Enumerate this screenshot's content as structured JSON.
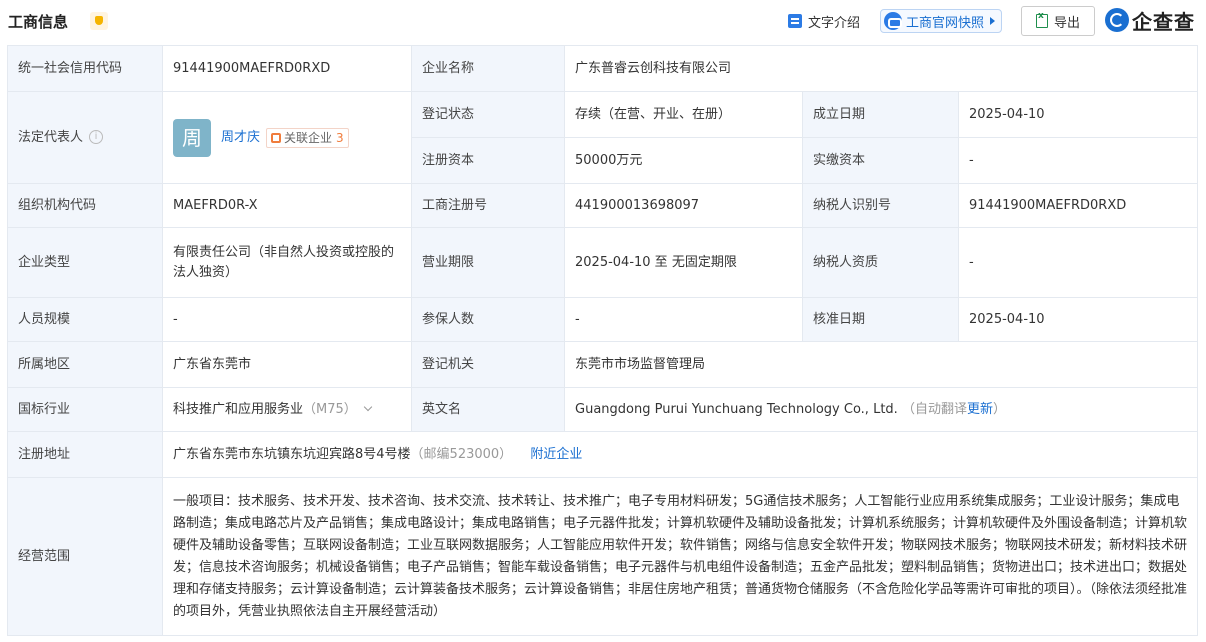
{
  "header": {
    "title": "工商信息",
    "intro_label": "文字介绍",
    "snapshot_label": "工商官网快照",
    "export_label": "导出",
    "logo_text": "企查查"
  },
  "rows": {
    "credit_code_label": "统一社会信用代码",
    "credit_code": "91441900MAEFRD0RXD",
    "company_name_label": "企业名称",
    "company_name": "广东普睿云创科技有限公司",
    "legal_rep_label": "法定代表人",
    "legal_rep_avatar": "周",
    "legal_rep_name": "周才庆",
    "related_label": "关联企业",
    "related_count": "3",
    "reg_status_label": "登记状态",
    "reg_status": "存续（在营、开业、在册）",
    "found_date_label": "成立日期",
    "found_date": "2025-04-10",
    "reg_capital_label": "注册资本",
    "reg_capital": "50000万元",
    "paid_capital_label": "实缴资本",
    "paid_capital": "-",
    "org_code_label": "组织机构代码",
    "org_code": "MAEFRD0R-X",
    "biz_reg_no_label": "工商注册号",
    "biz_reg_no": "441900013698097",
    "taxpayer_id_label": "纳税人识别号",
    "taxpayer_id": "91441900MAEFRD0RXD",
    "company_type_label": "企业类型",
    "company_type": "有限责任公司（非自然人投资或控股的法人独资）",
    "biz_term_label": "营业期限",
    "biz_term": "2025-04-10 至 无固定期限",
    "taxpayer_qual_label": "纳税人资质",
    "taxpayer_qual": "-",
    "staff_size_label": "人员规模",
    "staff_size": "-",
    "insured_label": "参保人数",
    "insured": "-",
    "approval_date_label": "核准日期",
    "approval_date": "2025-04-10",
    "region_label": "所属地区",
    "region": "广东省东莞市",
    "reg_authority_label": "登记机关",
    "reg_authority": "东莞市市场监督管理局",
    "industry_label": "国标行业",
    "industry": "科技推广和应用服务业",
    "industry_code": "（M75）",
    "english_name_label": "英文名",
    "english_name": "Guangdong Purui Yunchuang Technology Co., Ltd.",
    "auto_translate": "（自动翻译",
    "update_link": "更新",
    "auto_translate_end": "）",
    "address_label": "注册地址",
    "address": "广东省东莞市东坑镇东坑迎宾路8号4号楼",
    "postcode": "（邮编523000）",
    "nearby_link": "附近企业",
    "scope_label": "经营范围",
    "scope": "一般项目：技术服务、技术开发、技术咨询、技术交流、技术转让、技术推广；电子专用材料研发；5G通信技术服务；人工智能行业应用系统集成服务；工业设计服务；集成电路制造；集成电路芯片及产品销售；集成电路设计；集成电路销售；电子元器件批发；计算机软硬件及辅助设备批发；计算机系统服务；计算机软硬件及外围设备制造；计算机软硬件及辅助设备零售；互联网设备制造；工业互联网数据服务；人工智能应用软件开发；软件销售；网络与信息安全软件开发；物联网技术服务；物联网技术研发；新材料技术研发；信息技术咨询服务；机械设备销售；电子产品销售；智能车载设备销售；电子元器件与机电组件设备制造；五金产品批发；塑料制品销售；货物进出口；技术进出口；数据处理和存储支持服务；云计算设备制造；云计算装备技术服务；云计算设备销售；非居住房地产租赁；普通货物仓储服务（不含危险化学品等需许可审批的项目）。（除依法须经批准的项目外，凭营业执照依法自主开展经营活动）"
  }
}
